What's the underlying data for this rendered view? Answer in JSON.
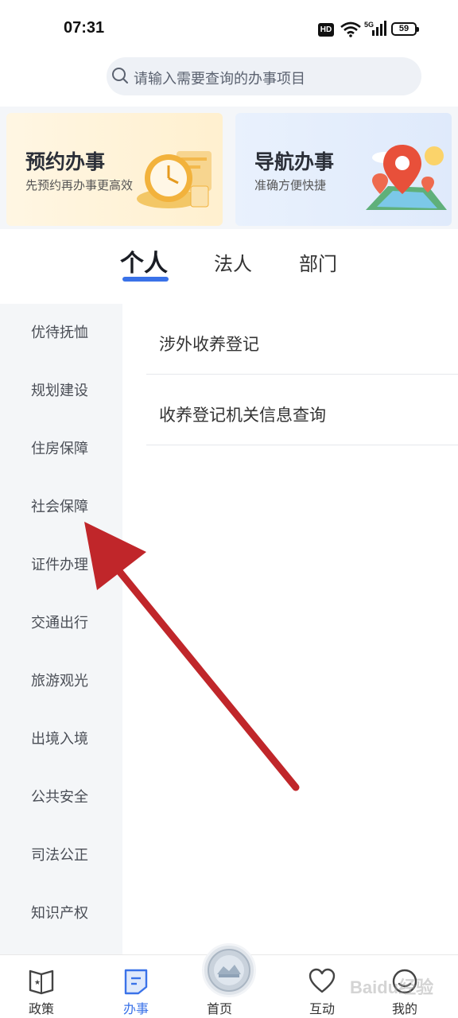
{
  "status_bar": {
    "time": "07:31",
    "hd": "HD",
    "network": "5G",
    "battery": "59"
  },
  "search": {
    "placeholder": "请输入需要查询的办事项目"
  },
  "banners": [
    {
      "title": "预约办事",
      "subtitle": "先预约再办事更高效"
    },
    {
      "title": "导航办事",
      "subtitle": "准确方便快捷"
    }
  ],
  "tabs": [
    {
      "label": "个人",
      "active": true
    },
    {
      "label": "法人",
      "active": false
    },
    {
      "label": "部门",
      "active": false
    }
  ],
  "sidebar": {
    "items": [
      "优待抚恤",
      "规划建设",
      "住房保障",
      "社会保障",
      "证件办理",
      "交通出行",
      "旅游观光",
      "出境入境",
      "公共安全",
      "司法公正",
      "知识产权"
    ]
  },
  "services": [
    "涉外收养登记",
    "收养登记机关信息查询"
  ],
  "tab_bar": {
    "items": [
      {
        "label": "政策",
        "icon": "policy-book-icon"
      },
      {
        "label": "办事",
        "icon": "service-doc-icon",
        "active": true
      },
      {
        "label": "首页",
        "icon": "home-emblem-icon"
      },
      {
        "label": "互动",
        "icon": "heart-icon"
      },
      {
        "label": "我的",
        "icon": "profile-icon"
      }
    ]
  },
  "watermark": "Baidu经验",
  "colors": {
    "accent": "#3a72e8",
    "annotation_arrow": "#c0262a",
    "sidebar_bg": "#f4f6f8"
  }
}
